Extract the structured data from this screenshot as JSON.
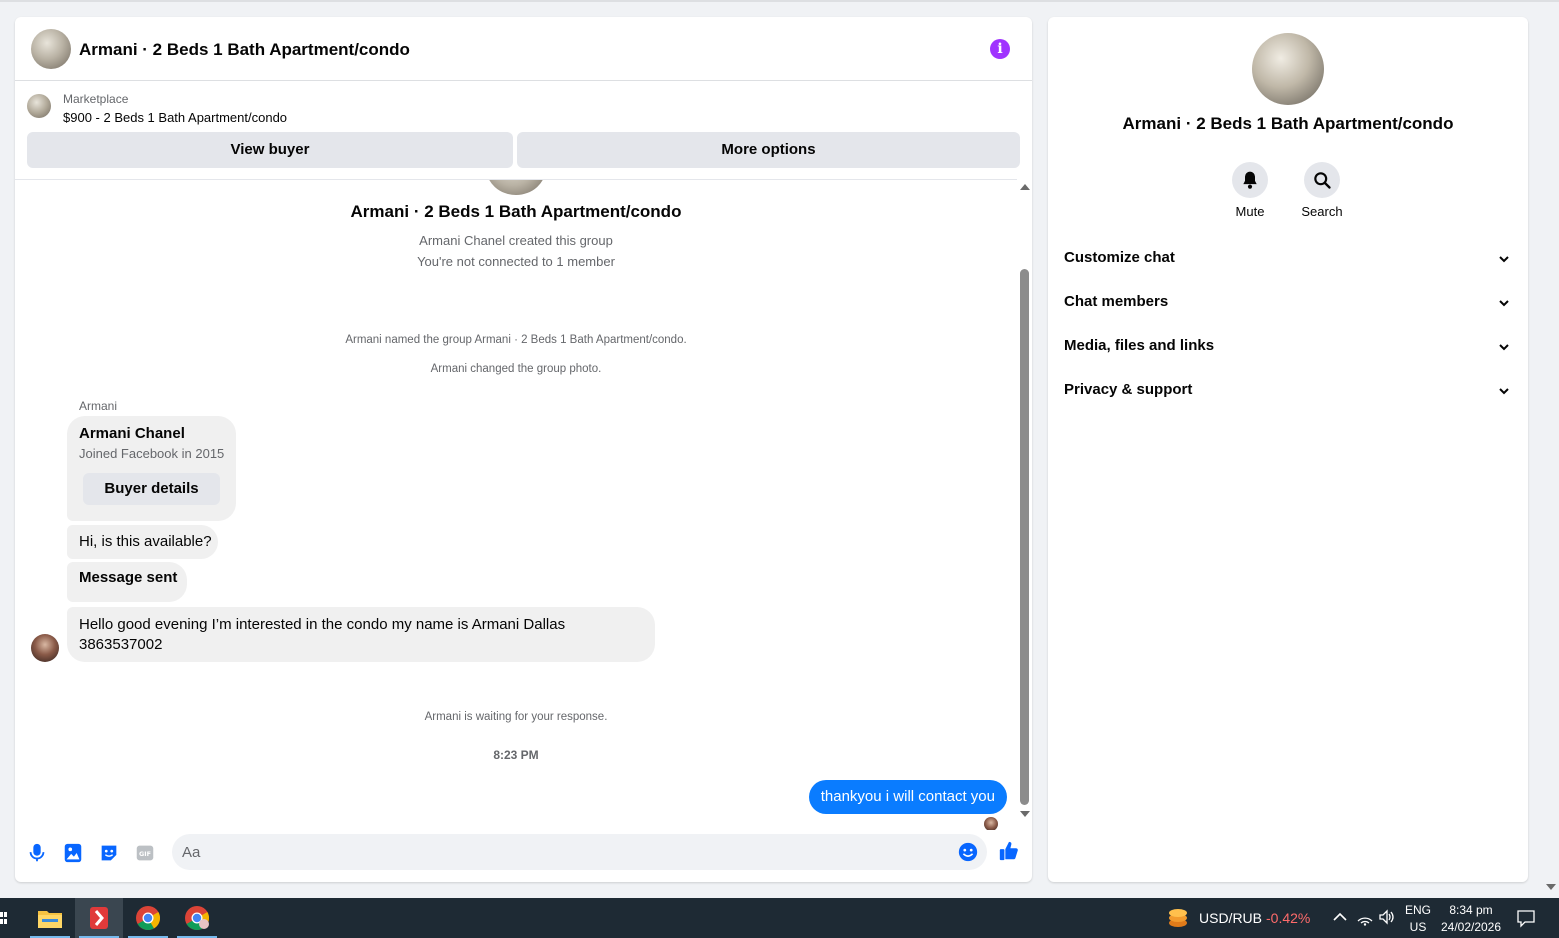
{
  "chat": {
    "title": "Armani · 2 Beds 1 Bath Apartment/condo",
    "marketplace_label": "Marketplace",
    "listing": "$900 - 2 Beds 1 Bath Apartment/condo",
    "view_buyer": "View buyer",
    "more_options": "More options"
  },
  "thread": {
    "group_title": "Armani · 2 Beds 1 Bath Apartment/condo",
    "created": "Armani Chanel created this group",
    "not_connected": "You're not connected to 1 member",
    "named_group": "Armani named the group Armani · 2 Beds 1 Bath Apartment/condo.",
    "changed_photo": "Armani changed the group photo.",
    "sender": "Armani",
    "card": {
      "name": "Armani Chanel",
      "joined": "Joined Facebook in 2015",
      "buyer_details": "Buyer details"
    },
    "messages": [
      {
        "text": "Hi, is this available?"
      },
      {
        "text": "Message sent"
      },
      {
        "text": "Hello good evening I’m interested in the condo my name is Armani Dallas 3863537002"
      }
    ],
    "waiting": "Armani is waiting for your response.",
    "time": "8:23 PM",
    "my_message": "thankyou i will contact you"
  },
  "composer": {
    "placeholder": "Aa",
    "value": ""
  },
  "side": {
    "title": "Armani · 2 Beds 1 Bath Apartment/condo",
    "mute": "Mute",
    "search": "Search",
    "sections": [
      "Customize chat",
      "Chat members",
      "Media, files and links",
      "Privacy & support"
    ]
  },
  "taskbar": {
    "pair": "USD/RUB",
    "change": "-0.42%",
    "lang": "ENG",
    "region": "US",
    "time": "8:34 pm",
    "date": "24/02/2026"
  },
  "colors": {
    "accent_blue": "#0a7cff",
    "info_purple": "#a033ff",
    "bubble_gray": "#f0f0f0",
    "taskbar": "#1e2a34",
    "negative": "#ff6b6b"
  },
  "icons": [
    "info-icon",
    "mic-icon",
    "image-icon",
    "sticker-icon",
    "gif-icon",
    "emoji-icon",
    "thumbs-up-icon",
    "bell-icon",
    "search-icon",
    "chevron-down-icon",
    "file-explorer-icon",
    "chrome-icon"
  ]
}
